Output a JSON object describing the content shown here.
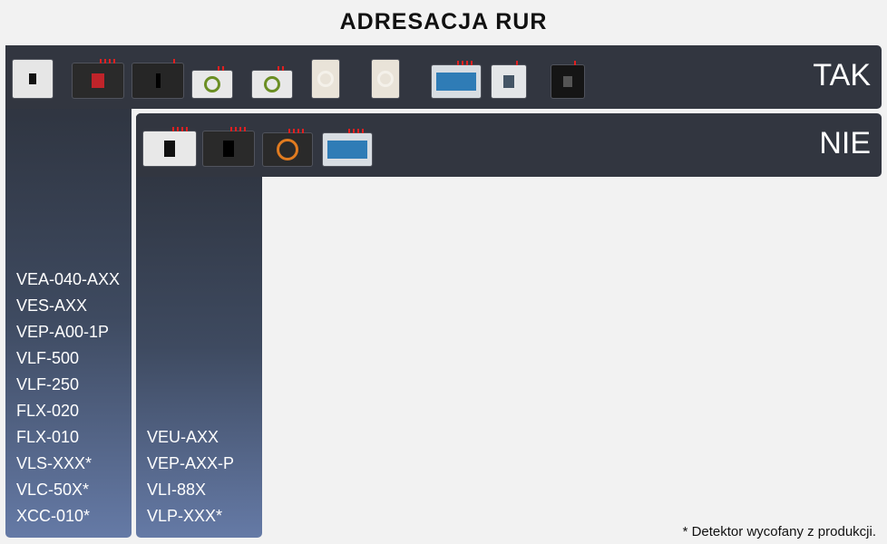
{
  "title": "ADRESACJA RUR",
  "tak": {
    "label": "TAK",
    "models": [
      "VEA-040-AXX",
      "VES-AXX",
      "VEP-A00-1P",
      "VLF-500",
      "VLF-250",
      "FLX-020",
      "FLX-010",
      "VLS-XXX*",
      "VLC-50X*",
      "XCC-010*"
    ],
    "devices": [
      {
        "icon": "white-detector-icon",
        "style": "white-tall",
        "leds": 0
      },
      {
        "icon": "dark-detector-with-display-icon",
        "style": "dark-red",
        "leds": 4
      },
      {
        "icon": "dark-slim-detector-icon",
        "style": "dark-slim",
        "leds": 1
      },
      {
        "icon": "white-round-indicator-detector-icon",
        "style": "white-ring",
        "leds": 2
      },
      {
        "icon": "white-round-indicator-detector-icon",
        "style": "white-ring",
        "leds": 2
      },
      {
        "icon": "round-face-detector-icon",
        "style": "cream-round",
        "leds": 0
      },
      {
        "icon": "round-face-detector-icon",
        "style": "cream-round",
        "leds": 0
      },
      {
        "icon": "blue-panel-detector-icon",
        "style": "blue-panel",
        "leds": 4
      },
      {
        "icon": "small-white-detector-icon",
        "style": "white-small",
        "leds": 1
      },
      {
        "icon": "black-square-detector-icon",
        "style": "black-square",
        "leds": 1
      }
    ]
  },
  "nie": {
    "label": "NIE",
    "models": [
      "VEU-AXX",
      "VEP-AXX-P",
      "VLI-88X",
      "VLP-XXX*"
    ],
    "devices": [
      {
        "icon": "white-detector-with-display-icon",
        "style": "white-display",
        "leds": 4
      },
      {
        "icon": "dark-detector-with-display-icon",
        "style": "dark-display",
        "leds": 4
      },
      {
        "icon": "orange-ring-detector-icon",
        "style": "orange-ring",
        "leds": 4
      },
      {
        "icon": "blue-panel-detector-icon",
        "style": "blue-panel",
        "leds": 4
      }
    ]
  },
  "footnote": "* Detektor wycofany z produkcji."
}
